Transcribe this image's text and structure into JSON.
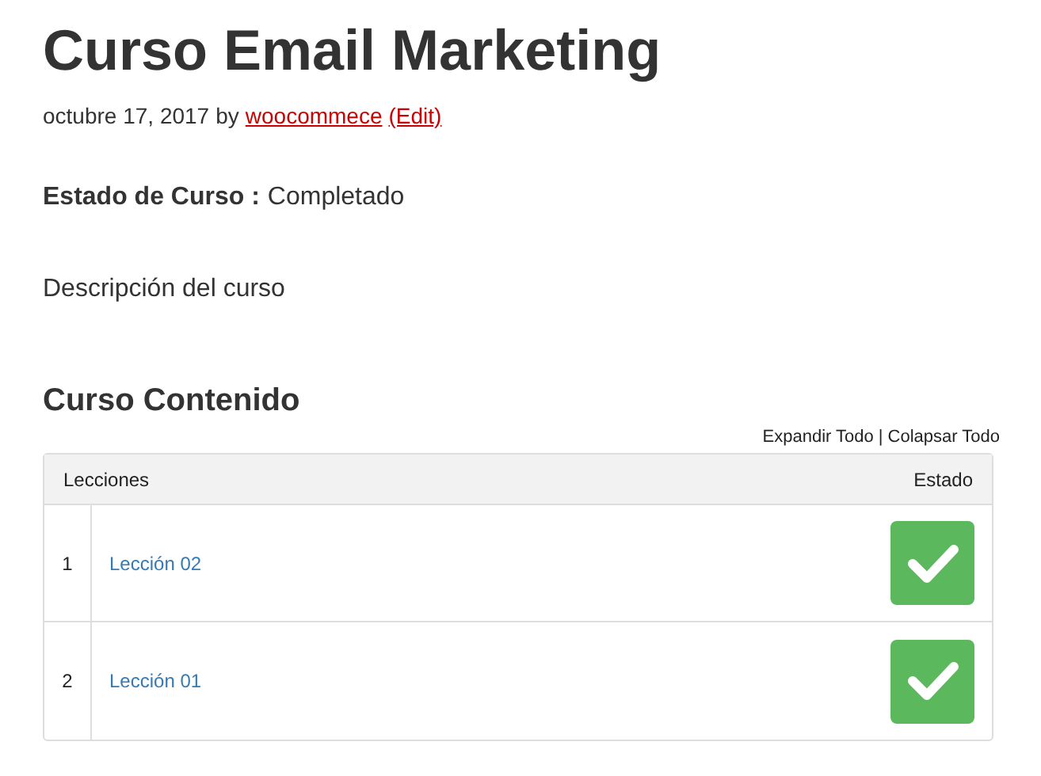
{
  "title": "Curso Email Marketing",
  "meta": {
    "date": "octubre 17, 2017",
    "by": "by",
    "author": "woocommece",
    "edit": "(Edit)"
  },
  "status": {
    "label": "Estado de Curso :",
    "value": "Completado"
  },
  "description": "Descripción del curso",
  "content": {
    "heading": "Curso Contenido",
    "expand": "Expandir Todo",
    "separator": "|",
    "collapse": "Colapsar Todo",
    "columns": [
      "Lecciones",
      "Estado"
    ],
    "lessons": [
      {
        "number": "1",
        "title": "Lección 02",
        "completed": true
      },
      {
        "number": "2",
        "title": "Lección 01",
        "completed": true
      }
    ]
  }
}
